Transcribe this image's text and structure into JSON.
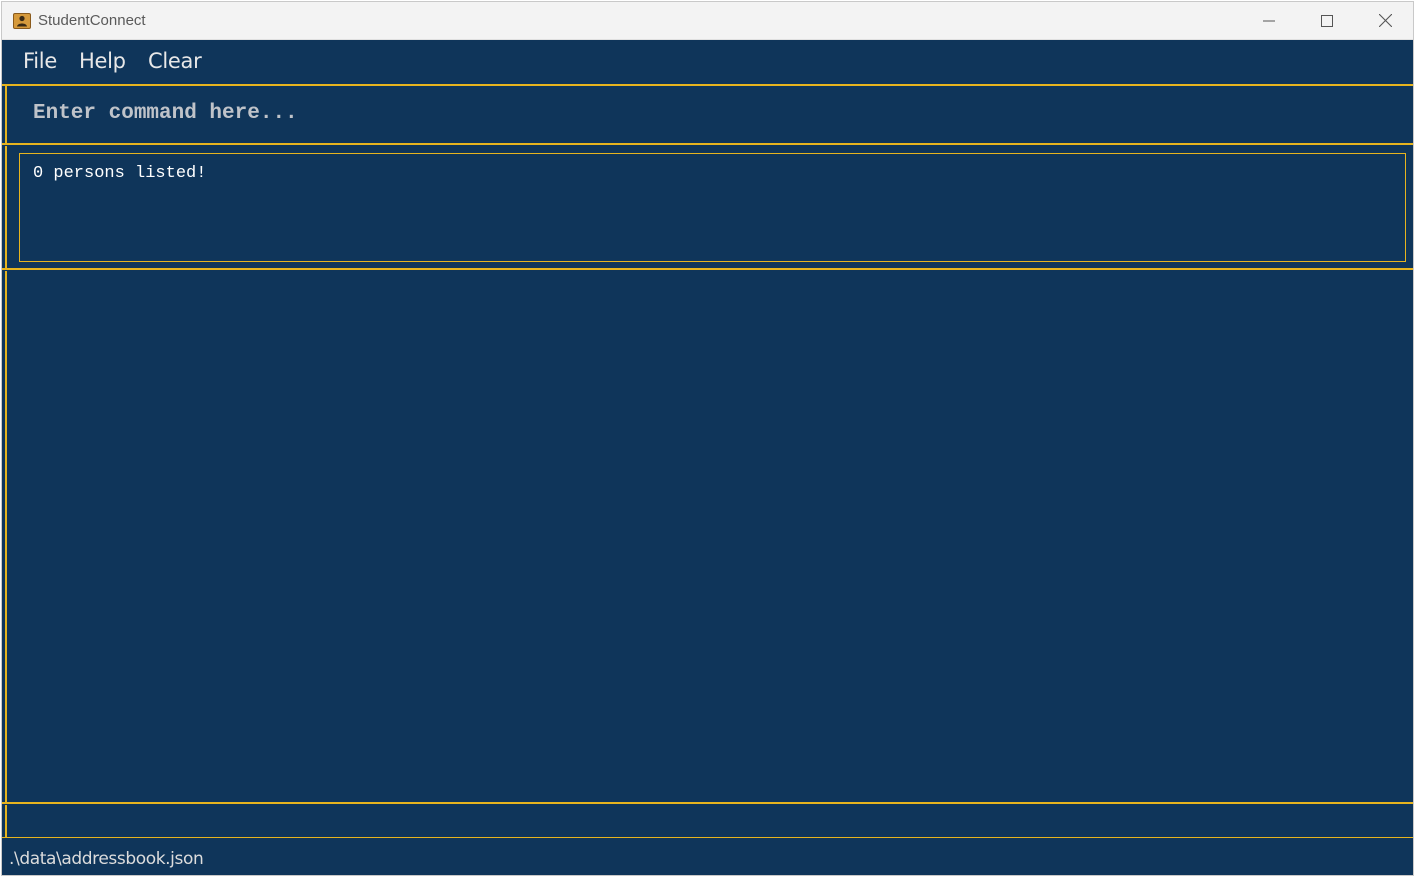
{
  "window": {
    "title": "StudentConnect"
  },
  "menu": {
    "items": [
      "File",
      "Help",
      "Clear"
    ]
  },
  "command": {
    "placeholder": "Enter command here...",
    "value": ""
  },
  "result": {
    "message": "0 persons listed!"
  },
  "status": {
    "file_path": ".\\data\\addressbook.json"
  },
  "icons": {
    "app": "app-icon",
    "minimize": "minimize-icon",
    "maximize": "maximize-icon",
    "close": "close-icon"
  },
  "colors": {
    "background": "#0f355a",
    "accent": "#e6b41f",
    "titlebar": "#f3f3f3"
  }
}
